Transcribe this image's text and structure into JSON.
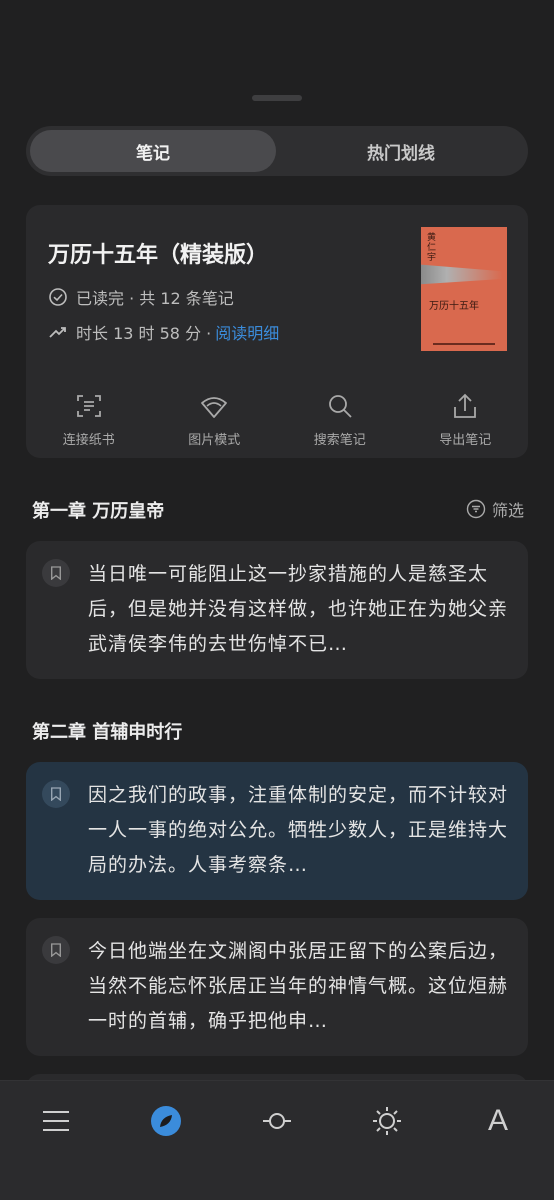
{
  "tabs": {
    "notes": "笔记",
    "hot": "热门划线"
  },
  "book": {
    "title": "万历十五年（精装版）",
    "status": "已读完 · 共 12 条笔记",
    "duration": "时长 13 时 58 分 ·",
    "detail_link": "阅读明细",
    "cover": {
      "author": "黄\n仁\n宇",
      "title": "万历十五年",
      "color": "#d9694e"
    }
  },
  "actions": [
    {
      "label": "连接纸书",
      "icon": "scan-icon"
    },
    {
      "label": "图片模式",
      "icon": "fan-icon"
    },
    {
      "label": "搜索笔记",
      "icon": "search-icon"
    },
    {
      "label": "导出笔记",
      "icon": "share-icon"
    }
  ],
  "filter_label": "筛选",
  "chapters": [
    {
      "title": "第一章 万历皇帝",
      "notes": [
        "当日唯一可能阻止这一抄家措施的人是慈圣太后，但是她并没有这样做，也许她正在为她父亲武清侯李伟的去世伤悼不已…"
      ]
    },
    {
      "title": "第二章 首辅申时行",
      "notes": [
        "因之我们的政事，注重体制的安定，而不计较对一人一事的绝对公允。牺牲少数人，正是维持大局的办法。人事考察条…",
        "今日他端坐在文渊阁中张居正留下的公案后边，当然不能忘怀张居正当年的神情气概。这位烜赫一时的首辅，确乎把他申…"
      ]
    }
  ],
  "bottom_nav": [
    {
      "icon": "menu-icon"
    },
    {
      "icon": "compass-icon",
      "active": true
    },
    {
      "icon": "progress-icon"
    },
    {
      "icon": "brightness-icon"
    },
    {
      "label": "A",
      "icon": "font-icon"
    }
  ],
  "colors": {
    "accent": "#3b8cdb",
    "highlight_note": "#243443"
  }
}
